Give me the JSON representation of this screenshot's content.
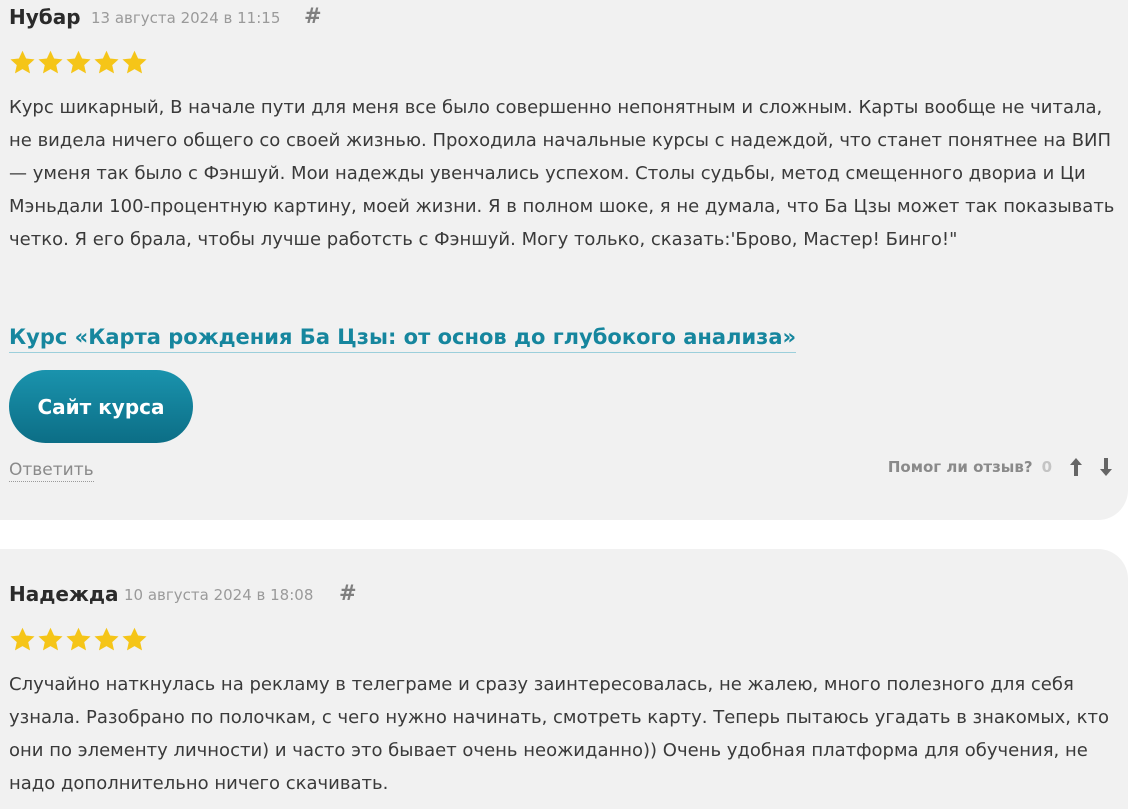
{
  "reviews": [
    {
      "author": "Нубар",
      "date": "13 августа 2024 в 11:15",
      "permalink": "#",
      "rating": 5,
      "text": "Курс шикарный, В начале пути для меня все было совершенно непонятным и сложным. Карты вообще не читала, не видела ничего общего со своей жизнью. Проходила начальные курсы с надеждой, что станет понятнее на ВИП — уменя так было с Фэншуй. Мои надежды увенчались успехом. Столы судьбы, метод смещенного двориа и Ци Мэньдали 100-процентную картину, моей жизни. Я в полном шоке, я не думала, что Ба Цзы может так показывать четко. Я его брала, чтобы лучше работсть с Фэншуй. Могу только, сказать:'Брово, Мастер! Бинго!\"",
      "course_link": "Курс «Карта рождения Ба Цзы: от основ до глубокого анализа»",
      "site_button": "Сайт курса",
      "reply": "Ответить",
      "helpful_label": "Помог ли отзыв?",
      "helpful_count": "0"
    },
    {
      "author": "Надежда",
      "date": "10 августа 2024 в 18:08",
      "permalink": "#",
      "rating": 5,
      "text": "Случайно наткнулась на рекламу в телеграме и сразу заинтересовалась, не жалею, много полезного для себя узнала. Разобрано по полочкам, с чего нужно начинать, смотреть карту. Теперь пытаюсь угадать в знакомых, кто они по элементу личности) и часто это бывает очень неожиданно)) Очень удобная платформа для обучения, не надо дополнительно ничего скачивать."
    }
  ],
  "icons": {
    "star": "star-icon",
    "vote_up": "arrow-up-icon",
    "vote_down": "arrow-down-icon"
  },
  "colors": {
    "star": "#f5c518",
    "accent": "#16869e",
    "card_bg": "#f1f1f1"
  }
}
